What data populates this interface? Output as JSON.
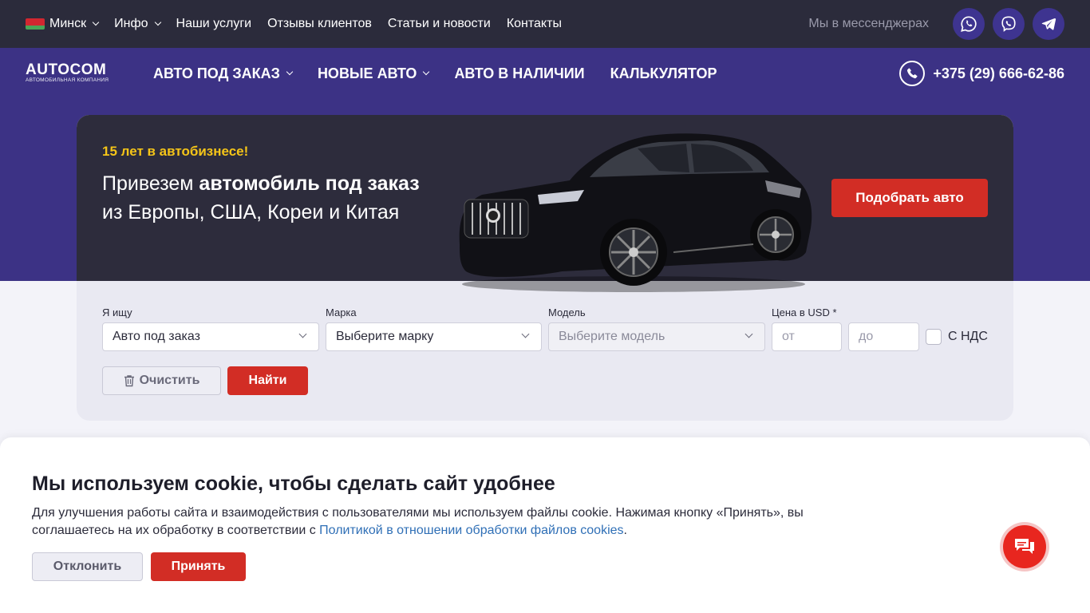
{
  "topbar": {
    "city": "Минск",
    "info": "Инфо",
    "services": "Наши услуги",
    "reviews": "Отзывы клиентов",
    "articles": "Статьи и новости",
    "contacts": "Контакты",
    "messengers_label": "Мы в мессенджерах",
    "flag_colors": [
      "#d22730",
      "#4aa657"
    ]
  },
  "nav": {
    "logo_main": "AUTOCOM",
    "logo_sub": "АВТОМОБИЛЬНАЯ КОМПАНИЯ",
    "items": [
      "АВТО ПОД ЗАКАЗ",
      "НОВЫЕ АВТО",
      "АВТО В НАЛИЧИИ",
      "КАЛЬКУЛЯТОР"
    ],
    "phone": "+375 (29) 666-62-86"
  },
  "hero": {
    "tag": "15 лет в автобизнесе!",
    "head_1": "Привезем ",
    "head_bold": "автомобиль под заказ",
    "head_2": " из Европы, США, Кореи и Китая",
    "cta": "Подобрать авто"
  },
  "filter": {
    "looking_label": "Я ищу",
    "looking_value": "Авто под заказ",
    "brand_label": "Марка",
    "brand_value": "Выберите марку",
    "model_label": "Модель",
    "model_value": "Выберите модель",
    "price_label": "Цена в USD *",
    "price_from_placeholder": "от",
    "price_to_placeholder": "до",
    "vat_label": "С НДС",
    "clear": "Очистить",
    "find": "Найти"
  },
  "cookie": {
    "title": "Мы используем cookie, чтобы сделать сайт удобнее",
    "text_1": "Для улучшения работы сайта и взаимодействия с пользователями мы используем файлы cookie. Нажимая кнопку «Принять», вы соглашаетесь на их обработку в соответствии с ",
    "link": "Политикой в отношении обработки файлов cookies",
    "text_2": ".",
    "decline": "Отклонить",
    "accept": "Принять"
  },
  "colors": {
    "accent_red": "#d22d25",
    "nav_purple": "#3c3285",
    "topbar_dark": "#2b2b3b",
    "tag_yellow": "#f5c518"
  }
}
